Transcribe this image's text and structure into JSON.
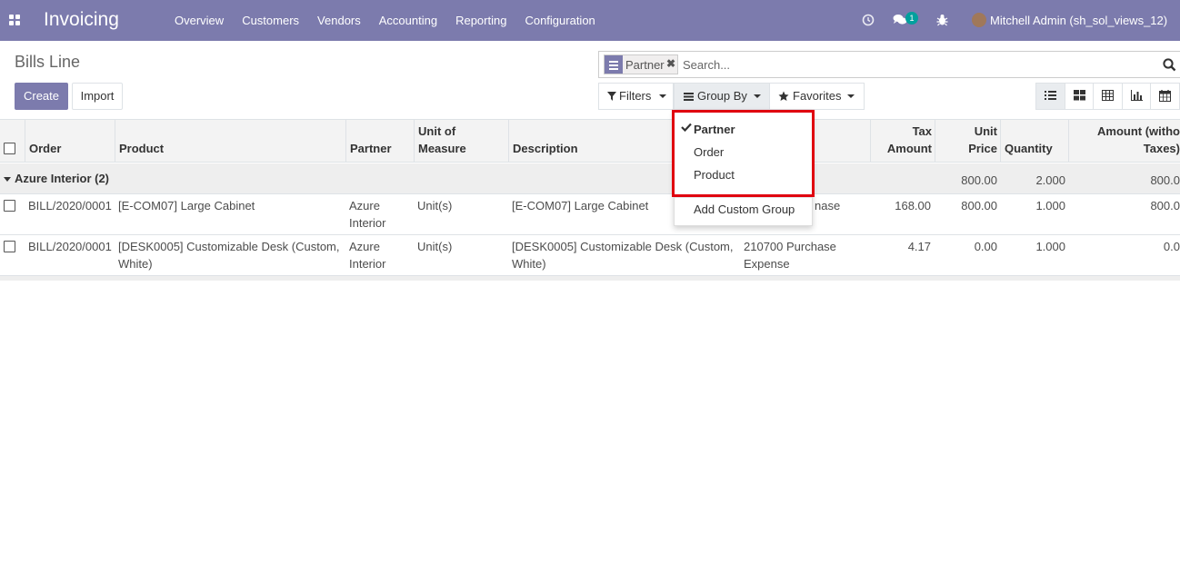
{
  "topbar": {
    "brand": "Invoicing",
    "menu": [
      "Overview",
      "Customers",
      "Vendors",
      "Accounting",
      "Reporting",
      "Configuration"
    ],
    "messages_count": "1",
    "user": "Mitchell Admin (sh_sol_views_12)"
  },
  "page": {
    "title": "Bills Line",
    "create_label": "Create",
    "import_label": "Import"
  },
  "search": {
    "facet": "Partner",
    "facet_remove": "✖",
    "placeholder": "Search..."
  },
  "controls": {
    "filters": "Filters",
    "group_by": "Group By",
    "favorites": "Favorites"
  },
  "groupby_menu": {
    "items": [
      {
        "label": "Partner",
        "checked": true
      },
      {
        "label": "Order",
        "checked": false
      },
      {
        "label": "Product",
        "checked": false
      }
    ],
    "add_custom": "Add Custom Group"
  },
  "table": {
    "headers": {
      "order": "Order",
      "product": "Product",
      "partner": "Partner",
      "uom_1": "Unit of",
      "uom_2": "Measure",
      "description": "Description",
      "tax_1": "Tax",
      "tax_2": "Amount",
      "price_1": "Unit",
      "price_2": "Price",
      "quantity": "Quantity",
      "amount_1": "Amount (witho",
      "amount_2": "Taxes)"
    },
    "group": {
      "label": "Azure Interior (2)",
      "unit_price": "800.00",
      "quantity": "2.000",
      "amount": "800.0"
    },
    "rows": [
      {
        "order": "BILL/2020/0001",
        "product_1": "[E-COM07] Large Cabinet",
        "product_2": "",
        "partner_1": "Azure",
        "partner_2": "Interior",
        "uom": "Unit(s)",
        "description_1": "[E-COM07] Large Cabinet",
        "description_2": "",
        "account_1": "nase",
        "account_2": "",
        "tax": "168.00",
        "price": "800.00",
        "quantity": "1.000",
        "amount": "800.0"
      },
      {
        "order": "BILL/2020/0001",
        "product_1": "[DESK0005] Customizable Desk (Custom,",
        "product_2": "White)",
        "partner_1": "Azure",
        "partner_2": "Interior",
        "uom": "Unit(s)",
        "description_1": "[DESK0005] Customizable Desk (Custom,",
        "description_2": "White)",
        "account_1": "210700 Purchase",
        "account_2": "Expense",
        "tax": "4.17",
        "price": "0.00",
        "quantity": "1.000",
        "amount": "0.0"
      }
    ]
  }
}
